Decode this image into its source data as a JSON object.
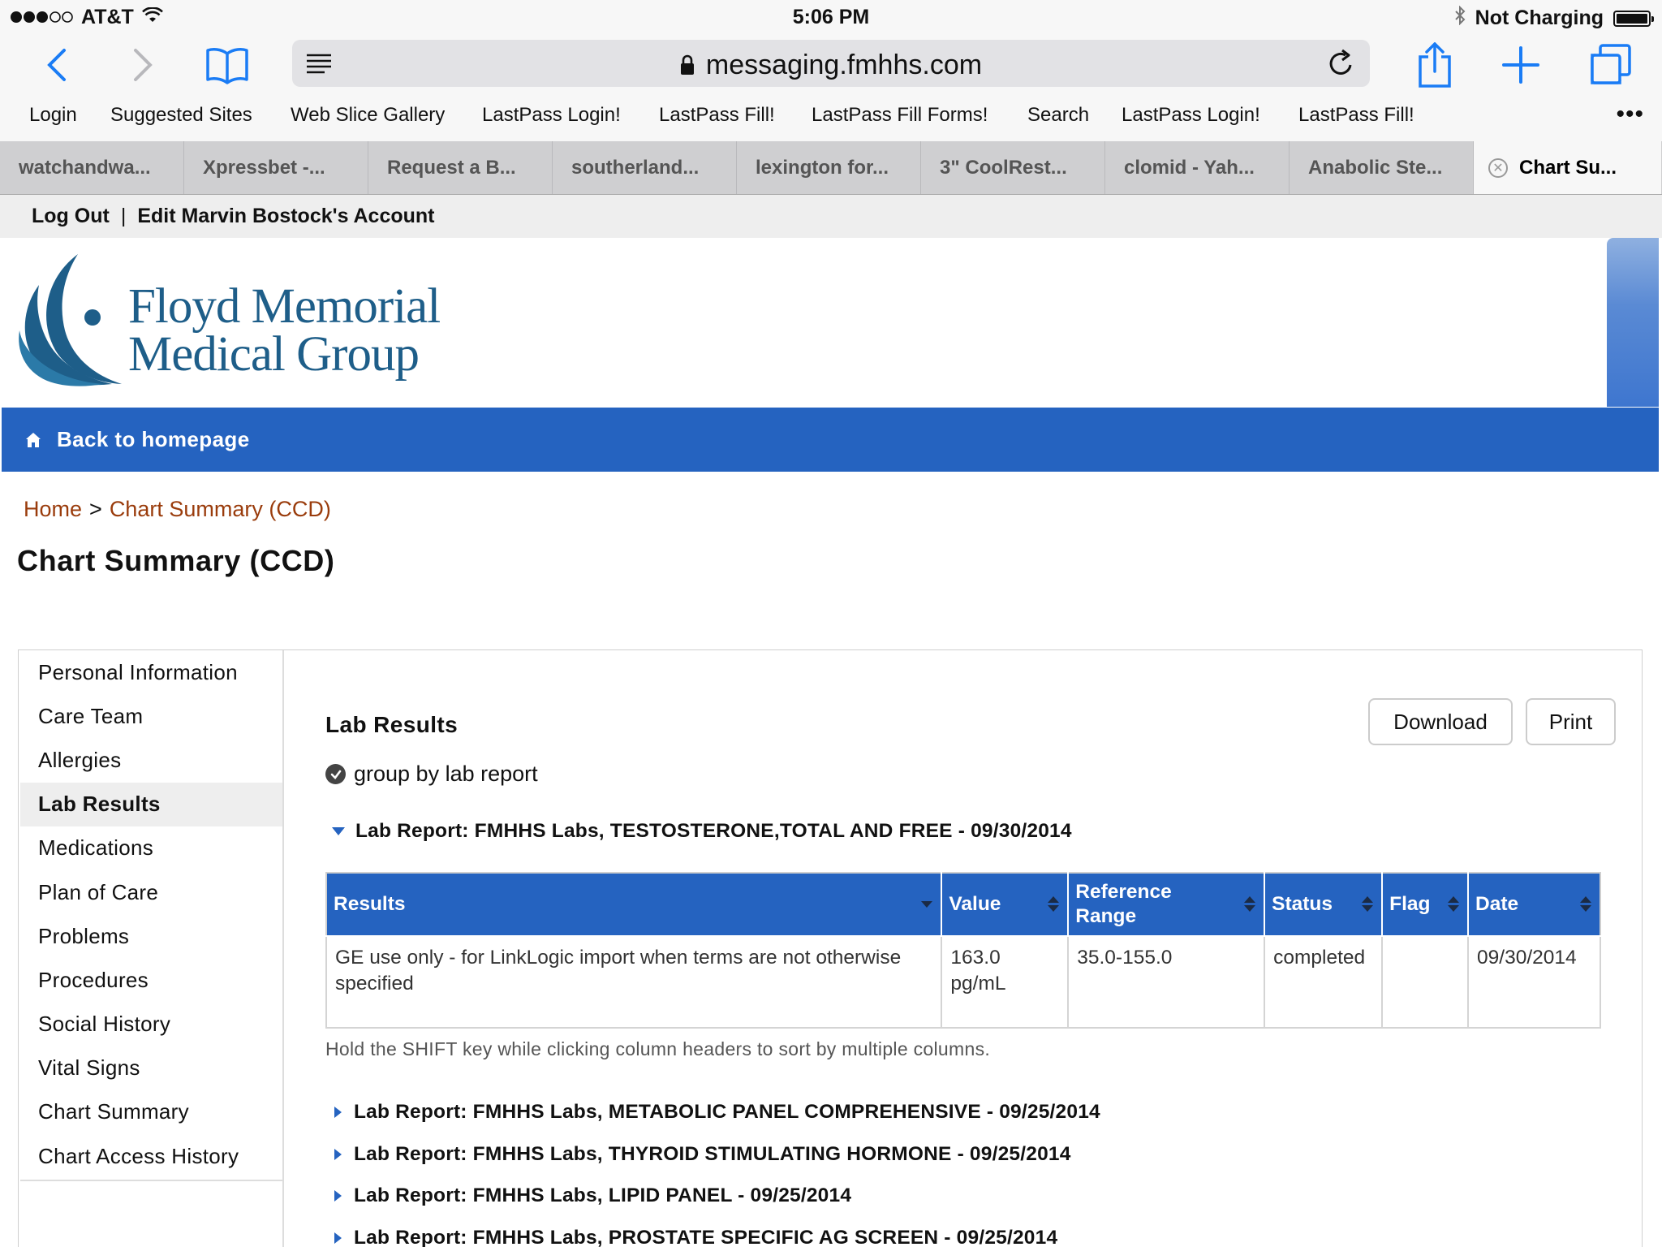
{
  "status_bar": {
    "carrier": "AT&T",
    "time": "5:06 PM",
    "charging": "Not Charging"
  },
  "browser": {
    "url": "messaging.fmhhs.com",
    "bookmarks": [
      "Login",
      "Suggested Sites",
      "Web Slice Gallery",
      "LastPass Login!",
      "LastPass Fill!",
      "LastPass Fill Forms!",
      "Search",
      "LastPass Login!",
      "LastPass Fill!"
    ],
    "bookmarks_more": "•••",
    "tabs": [
      "watchandwa...",
      "Xpressbet -...",
      "Request a B...",
      "southerland...",
      "lexington for...",
      "3\" CoolRest...",
      "clomid - Yah...",
      "Anabolic Ste...",
      "Chart Su..."
    ],
    "active_tab_index": 8
  },
  "account_bar": {
    "logout": "Log Out",
    "separator": "|",
    "edit_account": "Edit Marvin Bostock's Account"
  },
  "logo": {
    "line1": "Floyd Memorial",
    "line2": "Medical Group"
  },
  "nav": {
    "back_home": "Back to homepage"
  },
  "breadcrumb": {
    "home": "Home",
    "separator": ">",
    "current": "Chart Summary (CCD)"
  },
  "page_title": "Chart Summary (CCD)",
  "sidebar": {
    "items": [
      "Personal Information",
      "Care Team",
      "Allergies",
      "Lab Results",
      "Medications",
      "Plan of Care",
      "Problems",
      "Procedures",
      "Social History",
      "Vital Signs",
      "Chart Summary",
      "Chart Access History"
    ],
    "active": "Lab Results"
  },
  "lab_results": {
    "title": "Lab Results",
    "download_label": "Download",
    "print_label": "Print",
    "group_by_label": "group by lab report",
    "group_by_checked": true,
    "expanded_report": "Lab Report: FMHHS Labs, TESTOSTERONE,TOTAL AND FREE - 09/30/2014",
    "table": {
      "columns": [
        "Results",
        "Value",
        "Reference Range",
        "Status",
        "Flag",
        "Date"
      ],
      "rows": [
        {
          "result": "GE use only - for LinkLogic import when terms are not otherwise specified",
          "value": "163.0 pg/mL",
          "reference_range": "35.0-155.0",
          "status": "completed",
          "flag": "",
          "date": "09/30/2014"
        }
      ]
    },
    "sort_hint": "Hold the SHIFT key while clicking column headers to sort by multiple columns.",
    "collapsed_reports": [
      "Lab Report: FMHHS Labs, METABOLIC PANEL COMPREHENSIVE - 09/25/2014",
      "Lab Report: FMHHS Labs, THYROID STIMULATING HORMONE - 09/25/2014",
      "Lab Report: FMHHS Labs, LIPID PANEL - 09/25/2014",
      "Lab Report: FMHHS Labs, PROSTATE SPECIFIC AG SCREEN - 09/25/2014"
    ]
  },
  "colors": {
    "primary_blue": "#2563c0",
    "link_brown": "#9a3c0c",
    "logo_blue": "#1e5e89",
    "ios_blue": "#1a7cf5"
  }
}
